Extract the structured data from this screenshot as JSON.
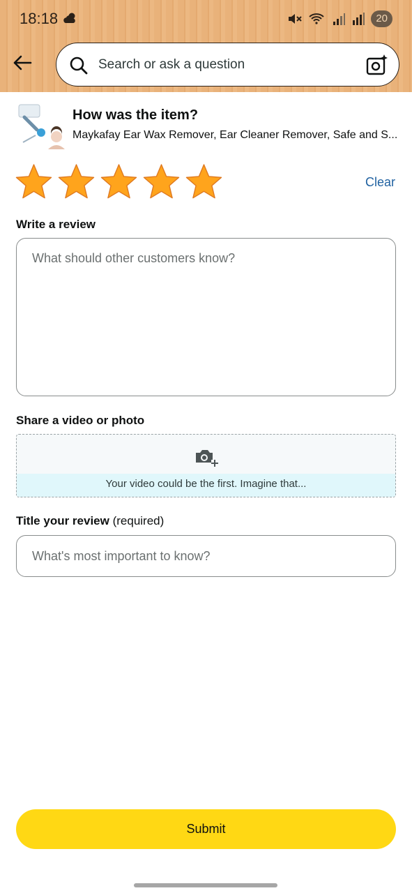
{
  "status_bar": {
    "time": "18:18",
    "battery": "20"
  },
  "search": {
    "placeholder": "Search or ask a question"
  },
  "product": {
    "question": "How was the item?",
    "name": "Maykafay Ear Wax Remover, Ear Cleaner Remover, Safe and S..."
  },
  "rating": {
    "stars": 5,
    "max": 5,
    "clear_label": "Clear"
  },
  "review": {
    "label": "Write a review",
    "placeholder": "What should other customers know?"
  },
  "media": {
    "label": "Share a video or photo",
    "hint": "Your video could be the first. Imagine that..."
  },
  "title": {
    "label": "Title your review",
    "label_suffix": " (required)",
    "placeholder": "What's most important to know?"
  },
  "submit_label": "Submit",
  "colors": {
    "star": "#ffa41c",
    "submit": "#ffd814",
    "link": "#2162a1",
    "header": "#e9b27a"
  }
}
